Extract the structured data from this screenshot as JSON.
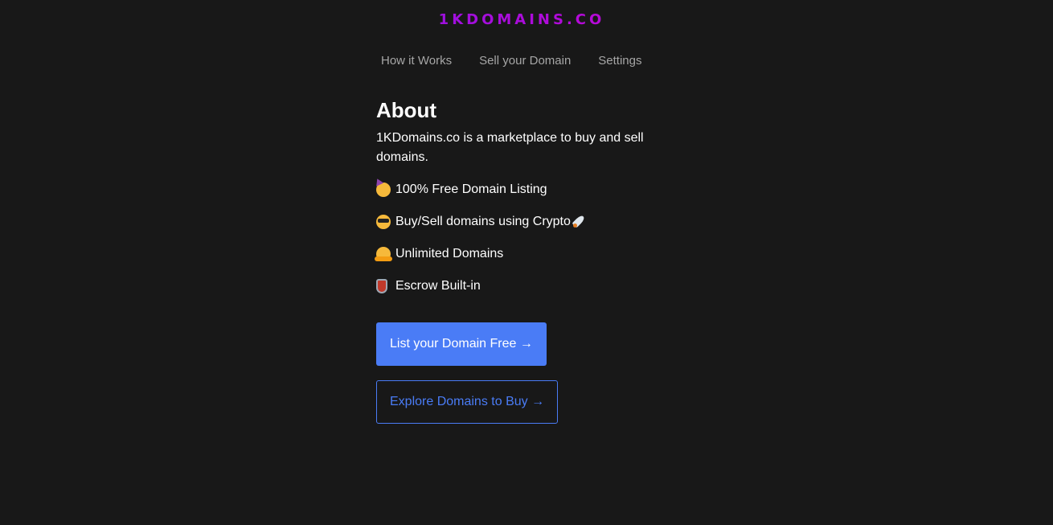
{
  "header": {
    "logo_text": "1KDOMAINS.CO"
  },
  "nav": {
    "items": [
      {
        "label": "How it Works"
      },
      {
        "label": "Sell your Domain"
      },
      {
        "label": "Settings"
      }
    ]
  },
  "about": {
    "title": "About",
    "description": "1KDomains.co is a marketplace to buy and sell domains.",
    "features": [
      {
        "icon": "partying-face-icon",
        "text": "100% Free Domain Listing"
      },
      {
        "icon": "cool-sunglasses-face-icon",
        "text": "Buy/Sell domains using Crypto",
        "trailing_icon": "rocket-icon"
      },
      {
        "icon": "hugging-face-icon",
        "text": "Unlimited Domains"
      },
      {
        "icon": "shield-icon",
        "text": "Escrow Built-in"
      }
    ]
  },
  "actions": {
    "list_free_label": "List your Domain Free →",
    "explore_label": "Explore Domains to Buy →"
  },
  "colors": {
    "background": "#181818",
    "accent": "#4a7cf6",
    "logo_gradient_start": "#5b21f0",
    "logo_gradient_end": "#ef06b5",
    "nav_text": "#a6a6a6"
  }
}
